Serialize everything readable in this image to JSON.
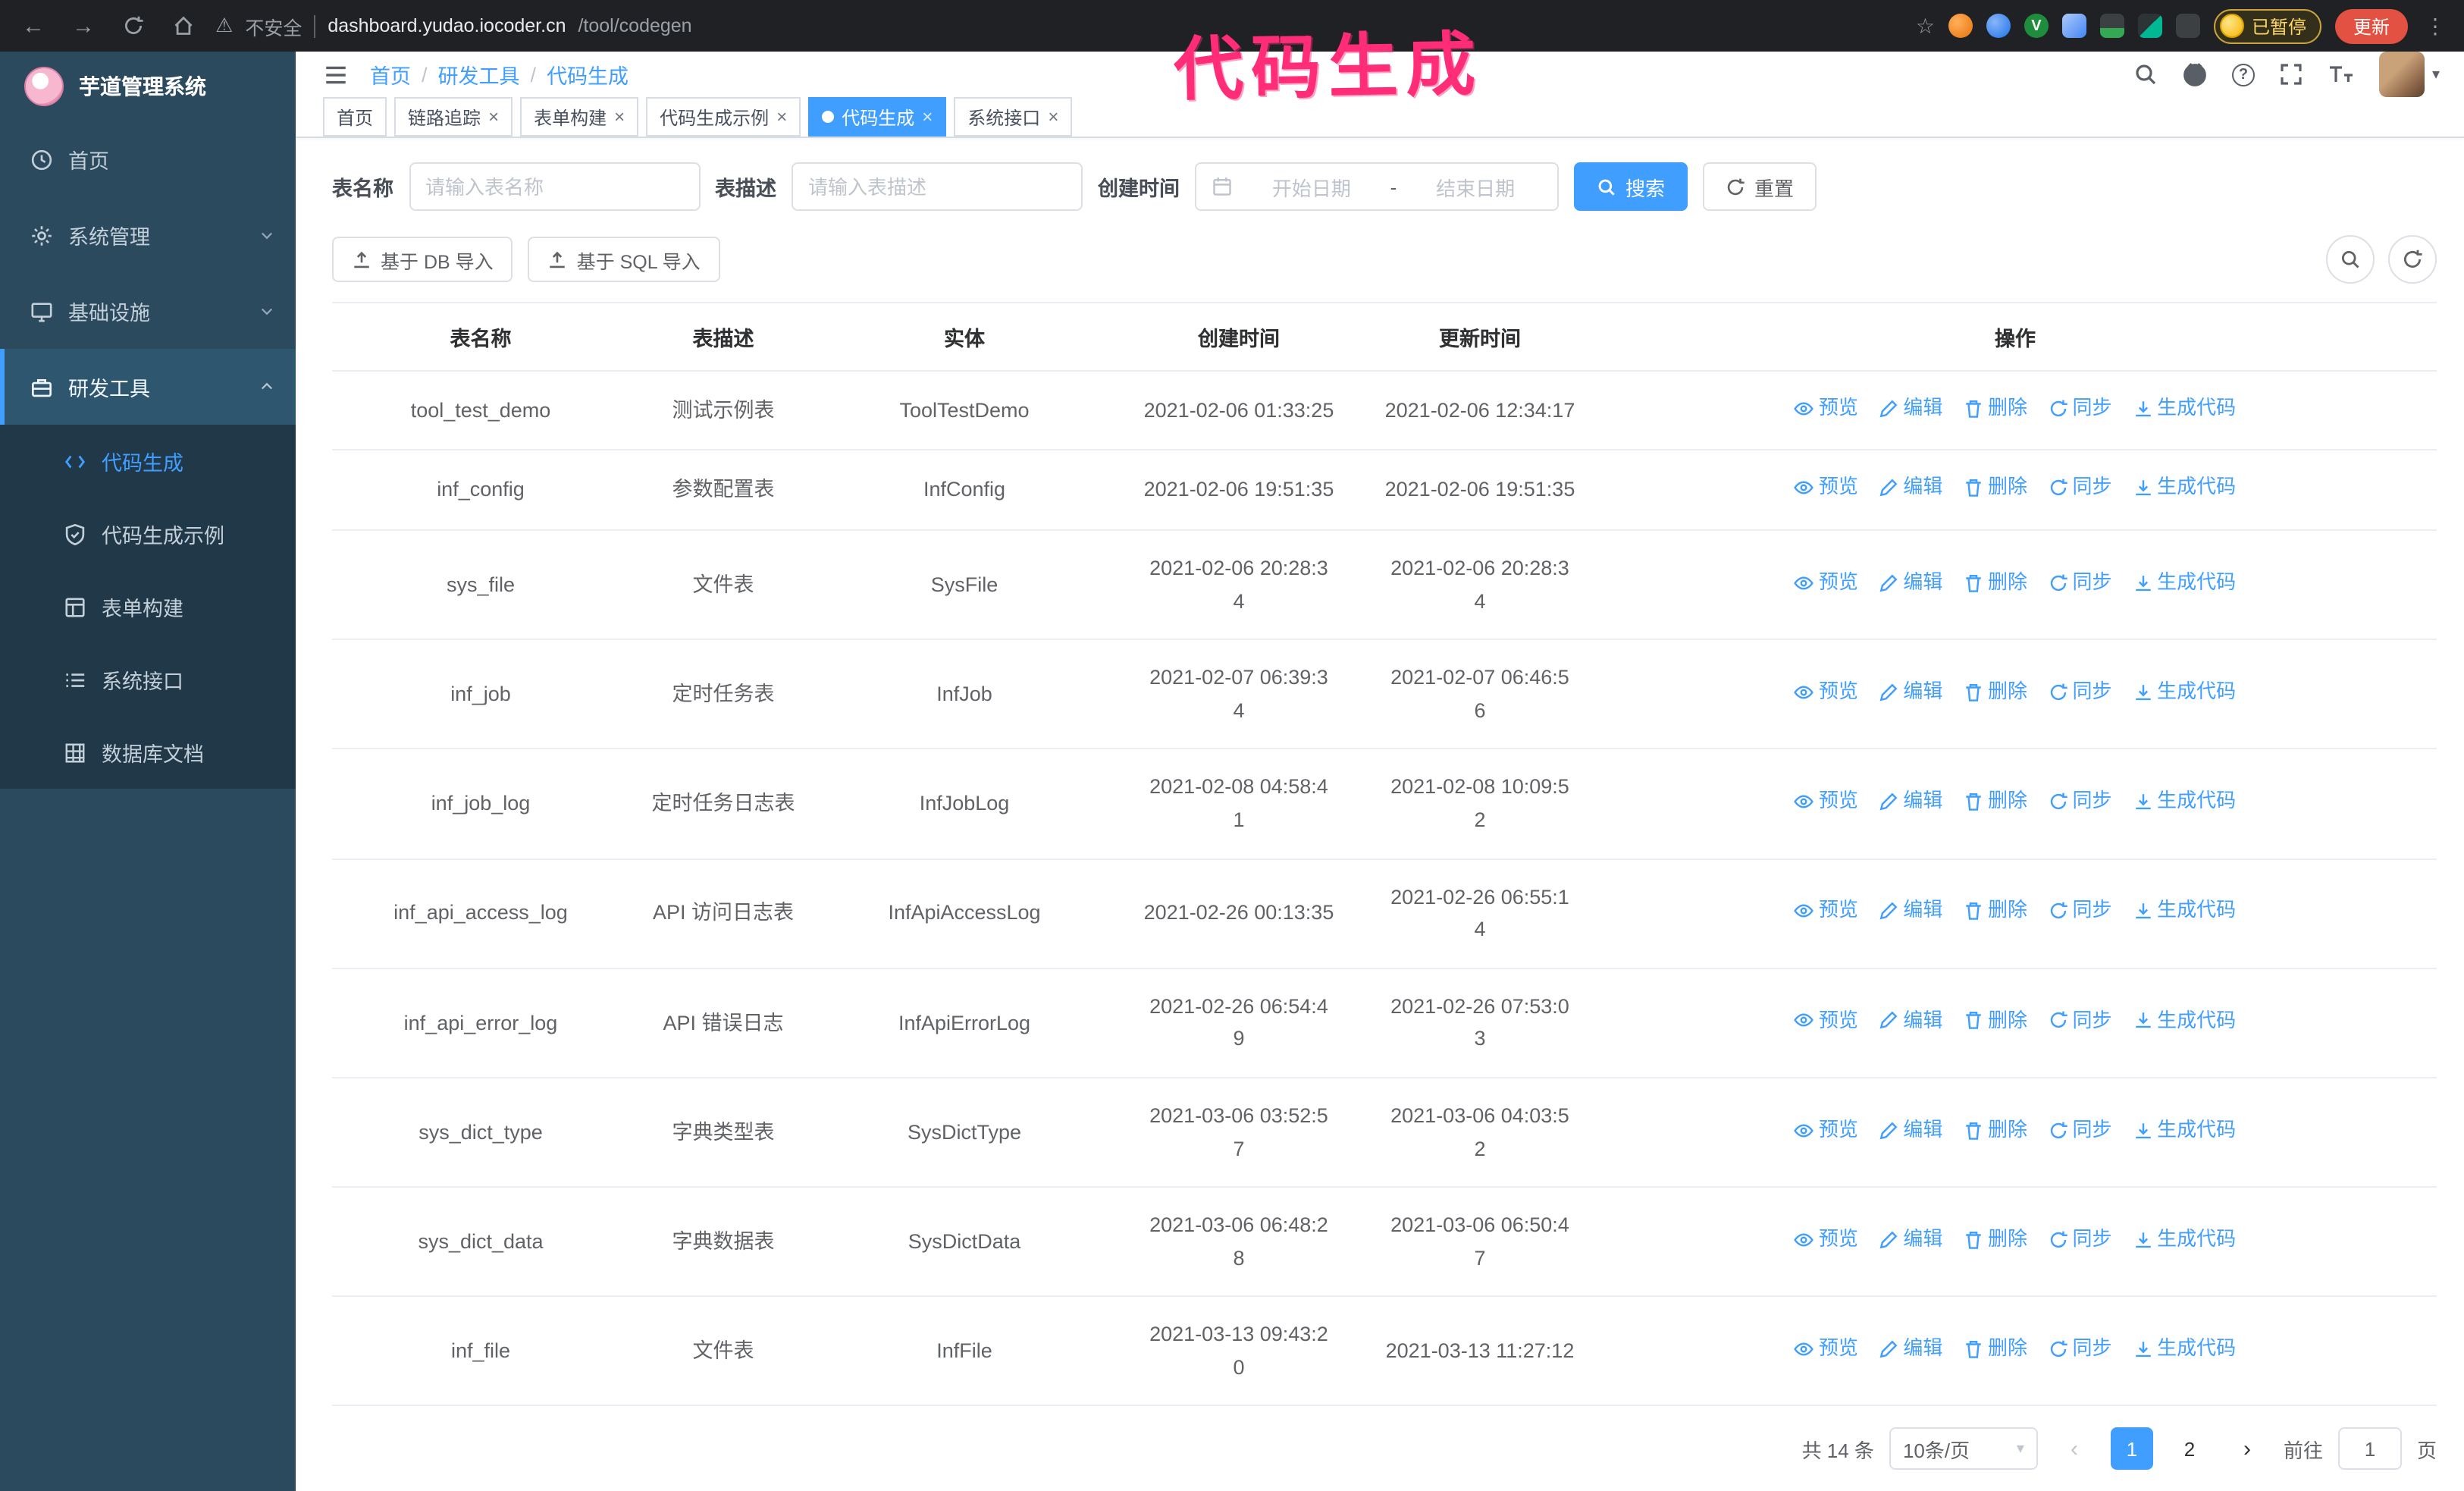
{
  "annotation": {
    "text": "代码生成"
  },
  "colors": {
    "accent": "#409eff",
    "sidebar": "#2b4a5e",
    "annotation": "#ff2d78",
    "update_button": "#e25142",
    "paused_text": "#fdd663"
  },
  "glyphs": {
    "back": "←",
    "forward": "→",
    "warning": "⚠",
    "star": "☆",
    "menu_dots": "⋮",
    "close": "×",
    "breadcrumb_sep": "/",
    "caret": "▾",
    "prev": "‹",
    "next": "›",
    "question": "?",
    "ext_check": "V"
  },
  "browser": {
    "security_label": "不安全",
    "url_host": "dashboard.yudao.iocoder.cn",
    "url_path": "/tool/codegen",
    "paused_badge": "已暂停",
    "update_label": "更新"
  },
  "sidebar": {
    "title": "芋道管理系统",
    "items": [
      {
        "label": "首页"
      },
      {
        "label": "系统管理"
      },
      {
        "label": "基础设施"
      },
      {
        "label": "研发工具"
      }
    ],
    "subitems": [
      {
        "label": "代码生成"
      },
      {
        "label": "代码生成示例"
      },
      {
        "label": "表单构建"
      },
      {
        "label": "系统接口"
      },
      {
        "label": "数据库文档"
      }
    ]
  },
  "header": {
    "breadcrumb": [
      "首页",
      "研发工具",
      "代码生成"
    ]
  },
  "tabs": [
    {
      "label": "首页"
    },
    {
      "label": "链路追踪"
    },
    {
      "label": "表单构建"
    },
    {
      "label": "代码生成示例"
    },
    {
      "label": "代码生成"
    },
    {
      "label": "系统接口"
    }
  ],
  "filters": {
    "table_name_label": "表名称",
    "table_name_placeholder": "请输入表名称",
    "table_desc_label": "表描述",
    "table_desc_placeholder": "请输入表描述",
    "create_time_label": "创建时间",
    "start_date_placeholder": "开始日期",
    "range_separator": "-",
    "end_date_placeholder": "结束日期",
    "search_label": "搜索",
    "reset_label": "重置"
  },
  "toolbar": {
    "db_import_label": "基于 DB 导入",
    "sql_import_label": "基于 SQL 导入"
  },
  "table": {
    "columns": [
      "表名称",
      "表描述",
      "实体",
      "创建时间",
      "更新时间",
      "操作"
    ],
    "rows": [
      {
        "name": "tool_test_demo",
        "desc": "测试示例表",
        "entity": "ToolTestDemo",
        "created": "2021-02-06 01:33:25",
        "updated": "2021-02-06 12:34:17"
      },
      {
        "name": "inf_config",
        "desc": "参数配置表",
        "entity": "InfConfig",
        "created": "2021-02-06 19:51:35",
        "updated": "2021-02-06 19:51:35"
      },
      {
        "name": "sys_file",
        "desc": "文件表",
        "entity": "SysFile",
        "created": "2021-02-06 20:28:3\n4",
        "updated": "2021-02-06 20:28:3\n4"
      },
      {
        "name": "inf_job",
        "desc": "定时任务表",
        "entity": "InfJob",
        "created": "2021-02-07 06:39:3\n4",
        "updated": "2021-02-07 06:46:5\n6"
      },
      {
        "name": "inf_job_log",
        "desc": "定时任务日志表",
        "entity": "InfJobLog",
        "created": "2021-02-08 04:58:4\n1",
        "updated": "2021-02-08 10:09:5\n2"
      },
      {
        "name": "inf_api_access_log",
        "desc": "API 访问日志表",
        "entity": "InfApiAccessLog",
        "created": "2021-02-26 00:13:35",
        "updated": "2021-02-26 06:55:1\n4"
      },
      {
        "name": "inf_api_error_log",
        "desc": "API 错误日志",
        "entity": "InfApiErrorLog",
        "created": "2021-02-26 06:54:4\n9",
        "updated": "2021-02-26 07:53:0\n3"
      },
      {
        "name": "sys_dict_type",
        "desc": "字典类型表",
        "entity": "SysDictType",
        "created": "2021-03-06 03:52:5\n7",
        "updated": "2021-03-06 04:03:5\n2"
      },
      {
        "name": "sys_dict_data",
        "desc": "字典数据表",
        "entity": "SysDictData",
        "created": "2021-03-06 06:48:2\n8",
        "updated": "2021-03-06 06:50:4\n7"
      },
      {
        "name": "inf_file",
        "desc": "文件表",
        "entity": "InfFile",
        "created": "2021-03-13 09:43:2\n0",
        "updated": "2021-03-13 11:27:12"
      }
    ]
  },
  "row_actions": {
    "preview": "预览",
    "edit": "编辑",
    "delete": "删除",
    "sync": "同步",
    "generate": "生成代码"
  },
  "pagination": {
    "total": "共 14 条",
    "page_size": "10条/页",
    "page1": "1",
    "page2": "2",
    "goto_label": "前往",
    "goto_value": "1",
    "unit_label": "页"
  }
}
